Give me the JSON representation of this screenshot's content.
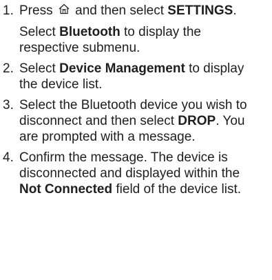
{
  "steps": [
    {
      "num": "1.",
      "line": {
        "pre": "Press",
        "icon": "home-icon",
        "mid": "and then select",
        "kw": "SETTINGS",
        "post": "."
      },
      "sub": {
        "pre": "Select",
        "kw": "Bluetooth",
        "post": "to display the respective submenu."
      }
    },
    {
      "num": "2.",
      "pre": "Select",
      "kw": "Device Management",
      "post": "to display the device list."
    },
    {
      "num": "3.",
      "pre": "Select the Bluetooth device you wish to disconnect and then select",
      "kw": "DROP",
      "post": ". You are prompted with a message."
    },
    {
      "num": "4.",
      "pre": "Confirm the message. The device is disconnected and displayed within the",
      "kw": "Not Connected",
      "post": "field of the device list."
    }
  ]
}
